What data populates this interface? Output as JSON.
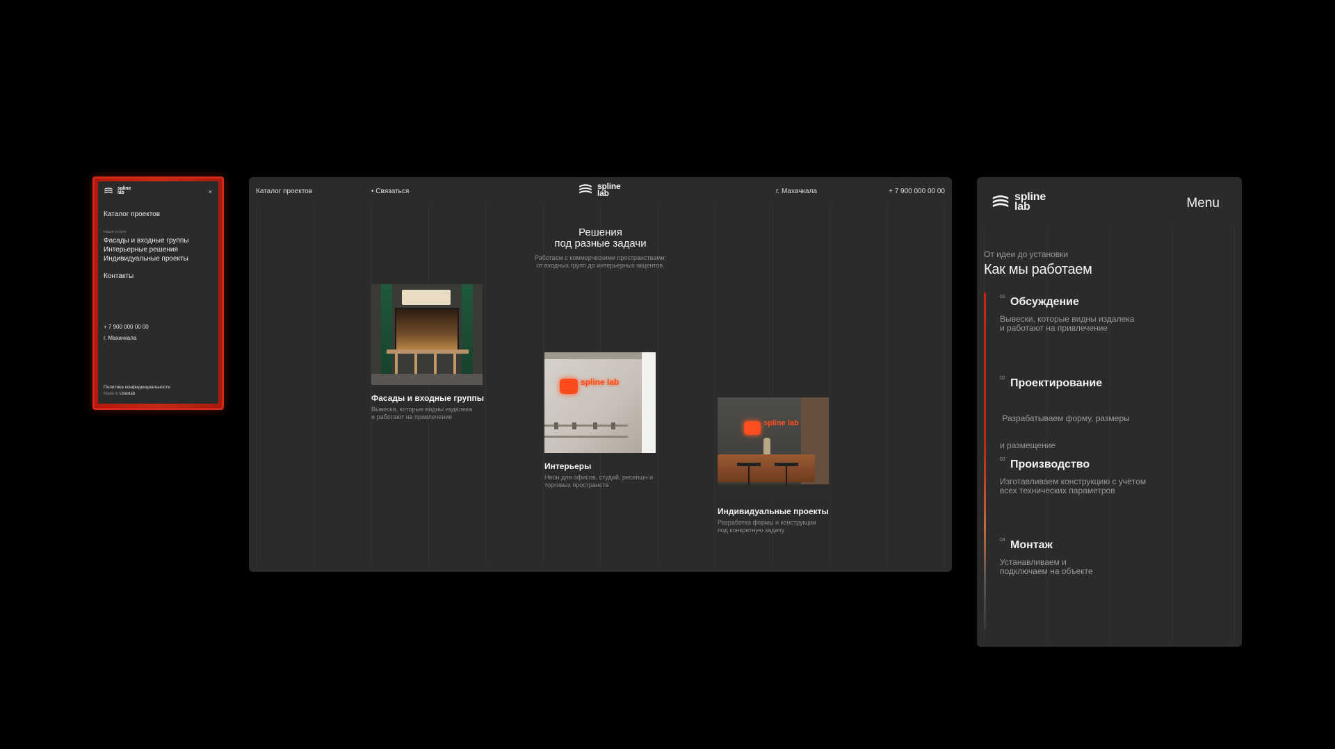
{
  "brand": {
    "line1": "spline",
    "line2": "lab",
    "accent": "#ff4a1c"
  },
  "mobile_menu": {
    "close_label": "×",
    "catalog": "Каталог проектов",
    "services_caption": "Наши услуги",
    "services": [
      "Фасады и входные группы",
      "Интерьерные решения",
      "Индивидуальные проекты"
    ],
    "contacts": "Контакты",
    "phone": "+ 7 900 000 00 00",
    "city": "г. Махачкала",
    "privacy": "Политика конфиденциальности",
    "made_in_prefix": "Made in ",
    "made_in_name": "Unexlab"
  },
  "desktop": {
    "nav": {
      "catalog": "Каталог проектов",
      "contact": "• Связаться",
      "city": "г. Махачкала",
      "phone": "+ 7 900 000 00 00"
    },
    "title_line1": "Решения",
    "title_line2": "под разные задачи",
    "subtitle_line1": "Работаем с коммерческими пространствами:",
    "subtitle_line2": "от входных групп до интерьерных акцентов.",
    "cards": [
      {
        "title": "Фасады и входные группы",
        "desc_line1": "Вывески, которые видны издалека",
        "desc_line2": "и работают на привлечение"
      },
      {
        "title": "Интерьеры",
        "desc_line1": "Неон для офисов, студий, ресепшн и",
        "desc_line2": "торговых пространств"
      },
      {
        "title": "Индивидуальные проекты",
        "desc_line1": "Разработка формы и конструкции",
        "desc_line2": "под конкретную задачу"
      }
    ],
    "photo_sign_text": "spline lab"
  },
  "process": {
    "menu_label": "Menu",
    "caption": "От идеи до установки",
    "title": "Как мы работаем",
    "steps": [
      {
        "num": "01",
        "title": "Обсуждение",
        "desc_line1": "Вывески, которые видны издалека",
        "desc_line2": "и работают на привлечение"
      },
      {
        "num": "02",
        "title": "Проектирование",
        "desc_line1": " Разрабатываем форму, размеры",
        "desc_line2": "и размещение"
      },
      {
        "num": "03",
        "title": "Производство",
        "desc_line1": "Изготавливаем конструкцию с учётом",
        "desc_line2": "всех технических параметров"
      },
      {
        "num": "04",
        "title": "Монтаж",
        "desc_line1": "Устанавливаем и",
        "desc_line2": "подключаем на объекте"
      }
    ]
  }
}
